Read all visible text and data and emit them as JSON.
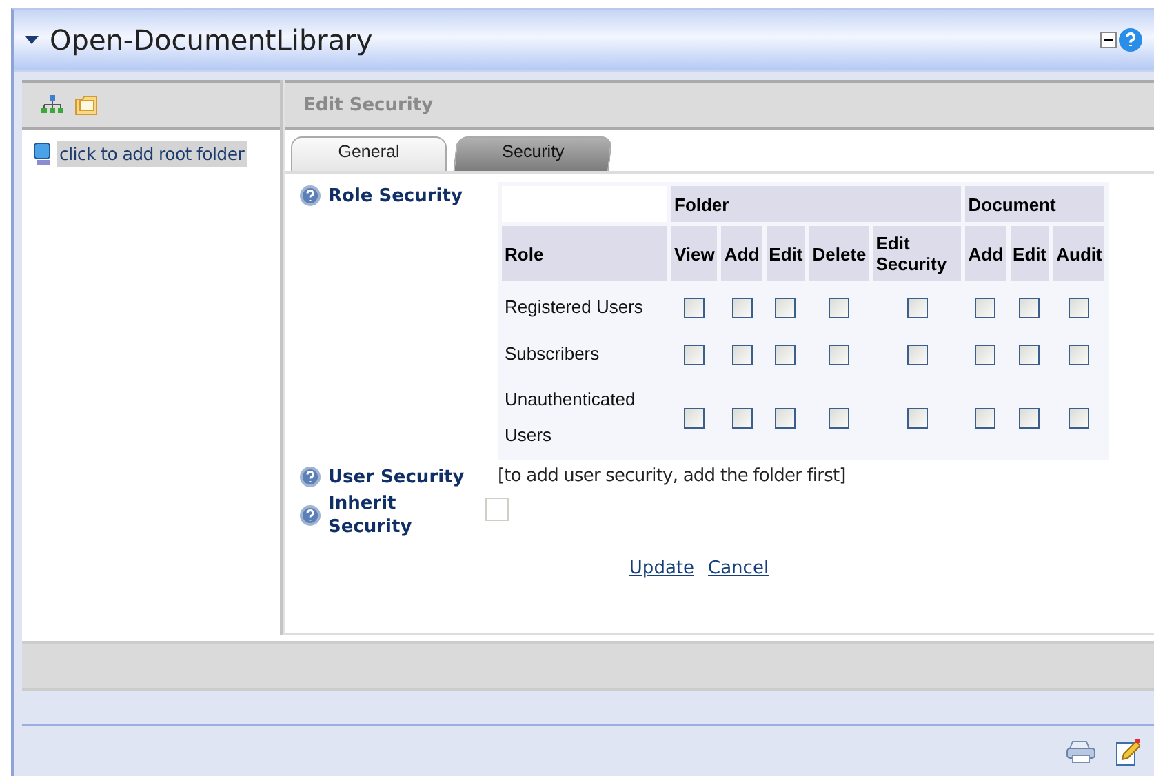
{
  "window": {
    "title": "Open-DocumentLibrary"
  },
  "tree": {
    "items": [
      {
        "label": "click to add root folder",
        "selected": true
      }
    ]
  },
  "panel": {
    "title": "Edit Security"
  },
  "tabs": [
    {
      "label": "General",
      "selected": false
    },
    {
      "label": "Security",
      "selected": true
    }
  ],
  "role_security": {
    "label": "Role Security",
    "role_header": "Role",
    "groups": [
      {
        "label": "Folder",
        "columns": [
          "View",
          "Add",
          "Edit",
          "Delete",
          "Edit Security"
        ]
      },
      {
        "label": "Document",
        "columns": [
          "Add",
          "Edit",
          "Audit"
        ]
      }
    ],
    "rows": [
      {
        "role": "Registered Users",
        "checks": [
          false,
          false,
          false,
          false,
          false,
          false,
          false,
          false
        ]
      },
      {
        "role": "Subscribers",
        "checks": [
          false,
          false,
          false,
          false,
          false,
          false,
          false,
          false
        ]
      },
      {
        "role": "Unauthenticated Users",
        "checks": [
          false,
          false,
          false,
          false,
          false,
          false,
          false,
          false
        ]
      }
    ]
  },
  "user_security": {
    "label": "User Security",
    "note": "[to add user security, add the folder first]"
  },
  "inherit_security": {
    "label": "Inherit Security",
    "checked": false,
    "disabled": true
  },
  "actions": [
    "Update",
    "Cancel"
  ]
}
